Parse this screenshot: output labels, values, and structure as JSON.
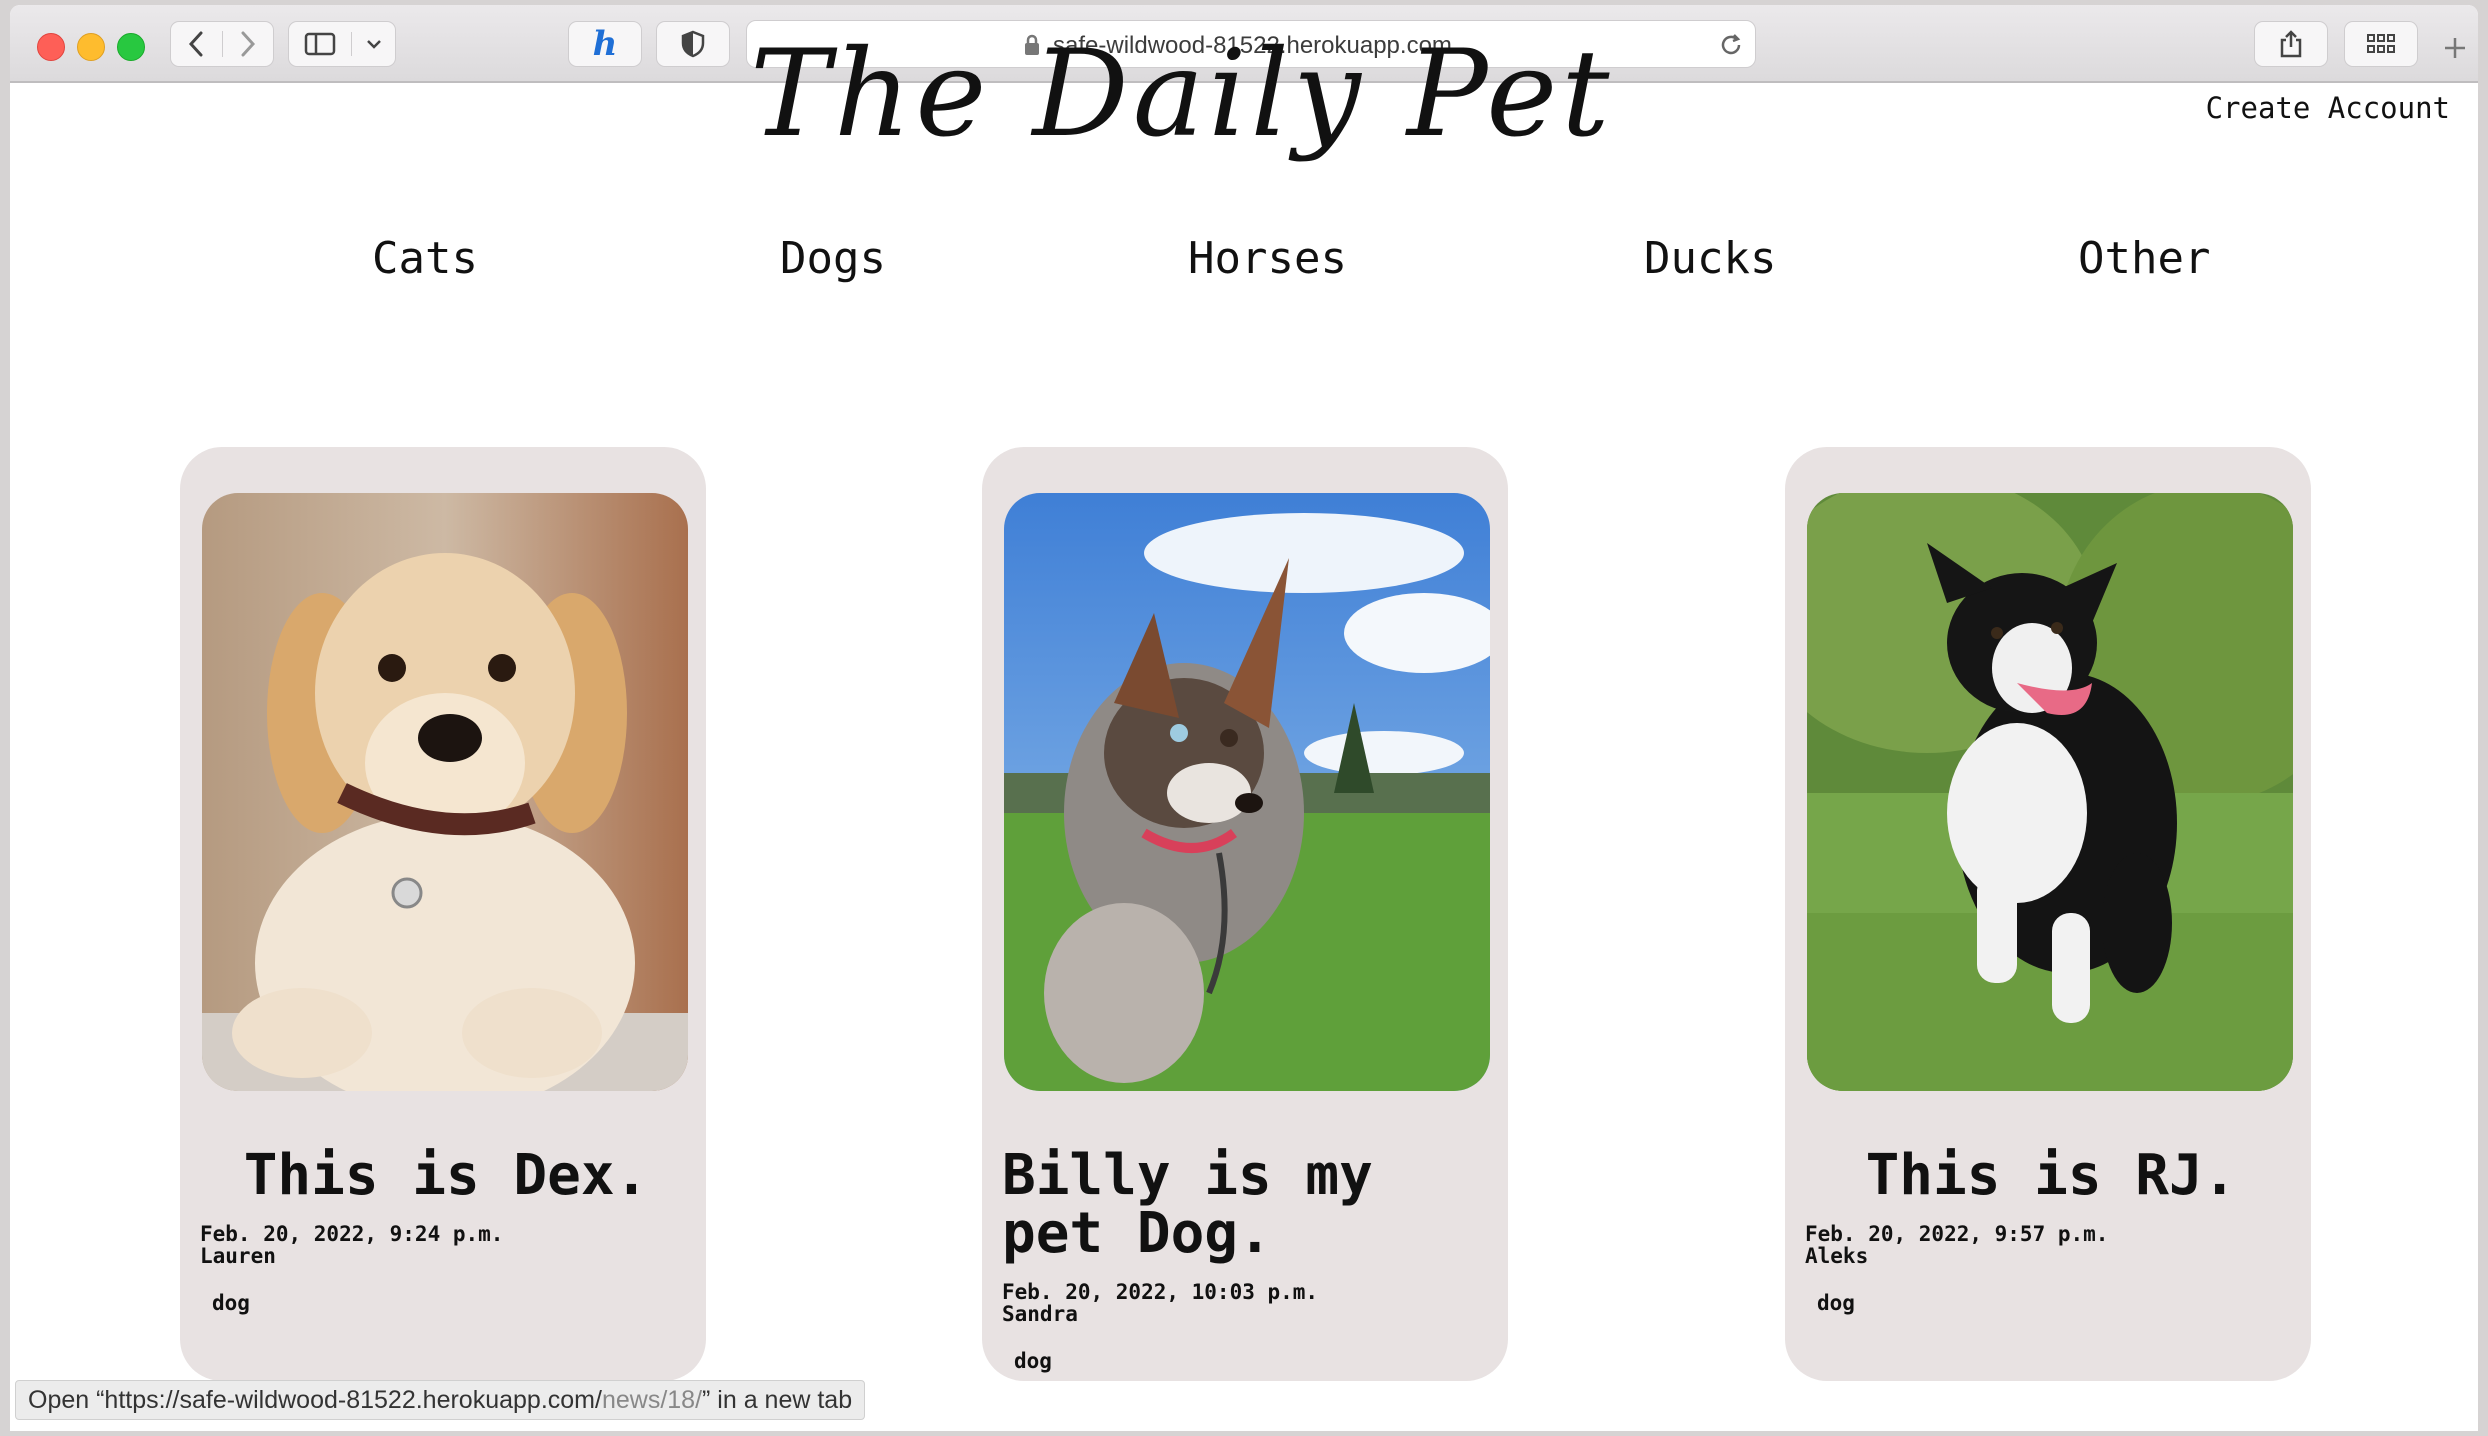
{
  "browser": {
    "url": "safe-wildwood-81522.herokuapp.com",
    "status_prefix": "Open “https://safe-wildwood-81522.herokuapp.com/",
    "status_path": "news/18/",
    "status_suffix": "” in a new tab"
  },
  "header": {
    "logo_text": "The Daily Pet",
    "create_account": "Create Account"
  },
  "nav": [
    "Cats",
    "Dogs",
    "Horses",
    "Ducks",
    "Other"
  ],
  "cards": [
    {
      "title": "This is Dex.",
      "date": "Feb. 20, 2022, 9:24 p.m.",
      "author": "Lauren",
      "tag": "dog",
      "image": "golden-retriever-puppy"
    },
    {
      "title": "Billy is my pet Dog.",
      "date": "Feb. 20, 2022, 10:03 p.m.",
      "author": "Sandra",
      "tag": "dog",
      "image": "merle-puppy-on-grass"
    },
    {
      "title": "This is RJ.",
      "date": "Feb. 20, 2022, 9:57 p.m.",
      "author": "Aleks",
      "tag": "dog",
      "image": "border-collie-running"
    }
  ],
  "colors": {
    "card_bg": "#e8e2e2",
    "page_bg": "#ffffff"
  }
}
